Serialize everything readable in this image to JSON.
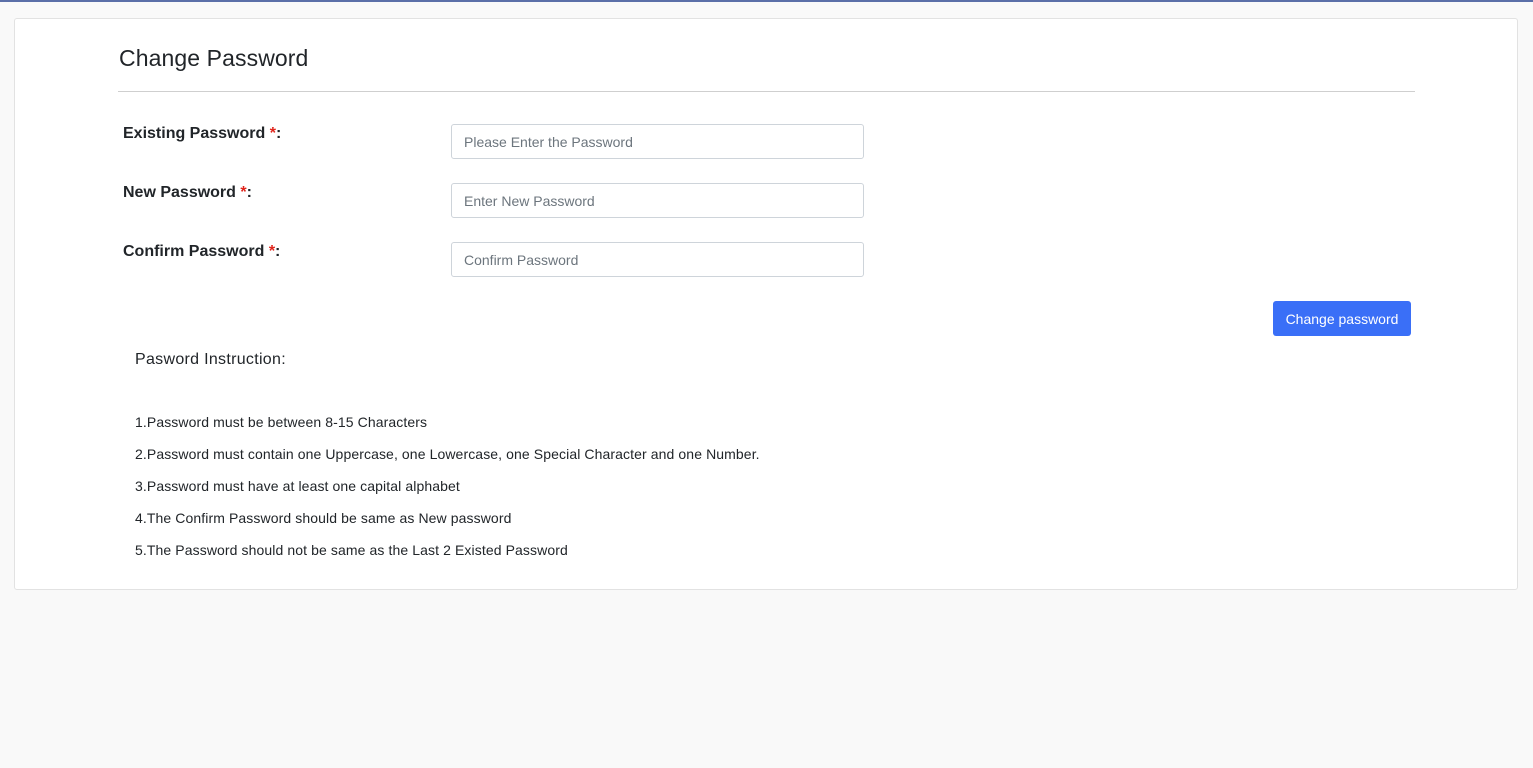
{
  "page": {
    "title": "Change Password"
  },
  "form": {
    "fields": [
      {
        "label": "Existing Password ",
        "required_mark": "*",
        "suffix": ":",
        "value": "",
        "placeholder": "Please Enter the Password"
      },
      {
        "label": "New Password ",
        "required_mark": "*",
        "suffix": ":",
        "value": "",
        "placeholder": "Enter New Password"
      },
      {
        "label": "Confirm Password ",
        "required_mark": "*",
        "suffix": ":",
        "value": "",
        "placeholder": "Confirm Password"
      }
    ],
    "submit_label": "Change password"
  },
  "instructions": {
    "heading": "Pasword Instruction:",
    "items": [
      "1.Password must be between 8-15 Characters",
      "2.Password must contain one Uppercase, one Lowercase, one Special Character and one Number.",
      "3.Password must have at least one capital alphabet",
      "4.The Confirm Password should be same as New password",
      "5.The Password should not be same as the Last 2 Existed Password"
    ]
  },
  "colors": {
    "accent": "#3a6ff7",
    "required": "#e0241b",
    "top_bar": "#5b6fa8"
  }
}
